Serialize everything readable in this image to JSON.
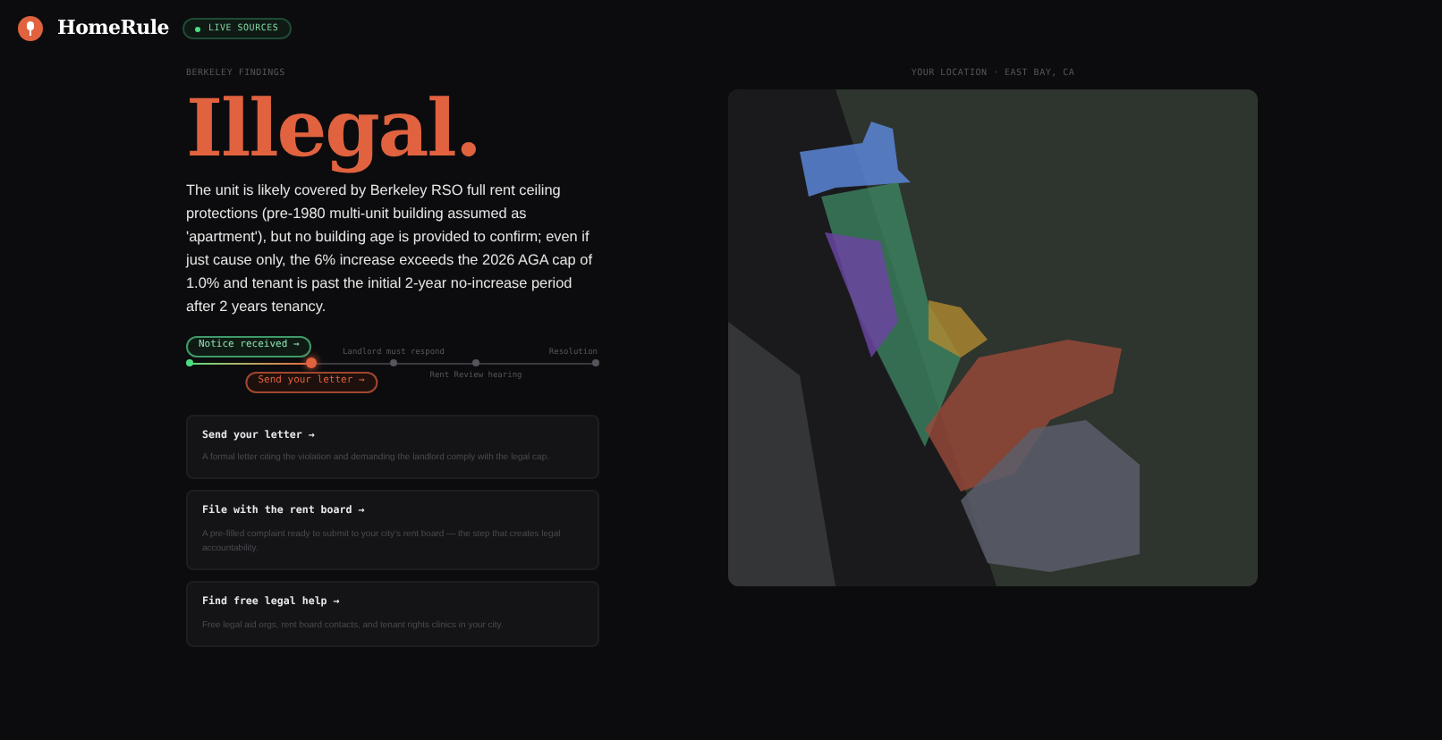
{
  "header": {
    "brand": "HomeRule",
    "badge": "LIVE SOURCES"
  },
  "findings": {
    "eyebrow": "BERKELEY FINDINGS",
    "verdict": "Illegal.",
    "summary": "The unit is likely covered by Berkeley RSO full rent ceiling protections (pre-1980 multi-unit building assumed as 'apartment'), but no building age is provided to confirm; even if just cause only, the 6% increase exceeds the 2026 AGA cap of 1.0% and tenant is past the initial 2-year no-increase period after 2 years tenancy."
  },
  "timeline": {
    "level": 0.3,
    "steps": [
      {
        "label": "Notice received →",
        "completed": true,
        "current": false
      },
      {
        "label": "Send your letter →",
        "completed": false,
        "current": true
      },
      {
        "label": "Landlord must respond",
        "completed": false,
        "current": false
      },
      {
        "label": "Rent Review hearing",
        "completed": false,
        "current": false
      },
      {
        "label": "Resolution",
        "completed": false,
        "current": false
      }
    ]
  },
  "actions": [
    {
      "title": "Send your letter →",
      "description": "A formal letter citing the violation and demanding the landlord comply with the legal cap."
    },
    {
      "title": "File with the rent board →",
      "description": "A pre-filled complaint ready to submit to your city's rent board — the step that creates legal accountability."
    },
    {
      "title": "Find free legal help →",
      "description": "Free legal aid orgs, rent board contacts, and tenant rights clinics in your city."
    }
  ],
  "map": {
    "caption": "YOUR LOCATION · EAST BAY, CA"
  }
}
